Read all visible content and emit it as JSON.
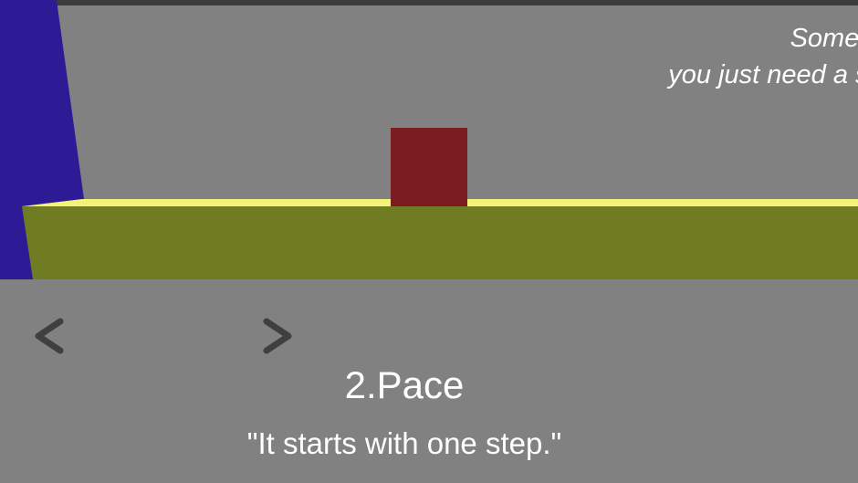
{
  "hint": {
    "line1": "Sometim",
    "line2": "you just need a sl"
  },
  "level": {
    "title": "2.Pace",
    "quote": "\"It starts with one step.\""
  },
  "nav": {
    "prev_icon": "chevron-left-icon",
    "next_icon": "chevron-right-icon"
  },
  "colors": {
    "background": "#818181",
    "wall": "#2d1b96",
    "platform_top": "#f4f279",
    "platform_front": "#6f7c21",
    "player_block": "#7a1c20",
    "text": "#ffffff",
    "nav_arrow": "#3f3f3f"
  }
}
